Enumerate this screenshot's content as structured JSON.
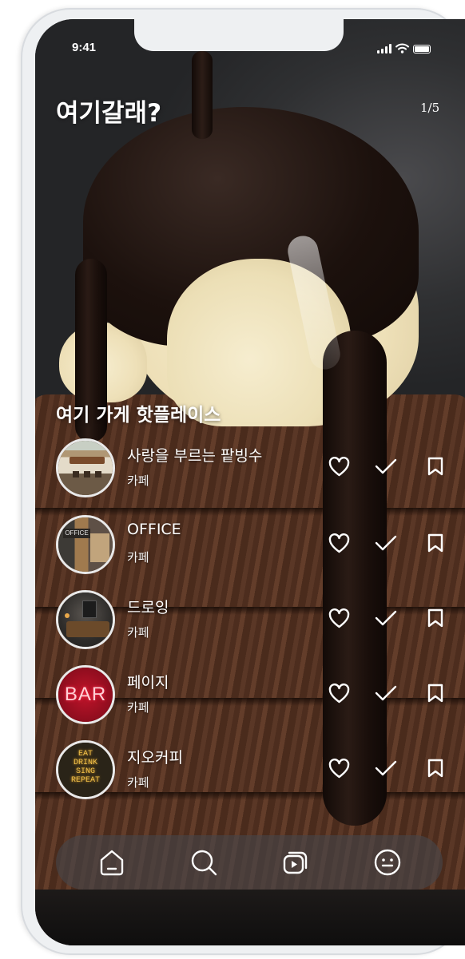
{
  "status": {
    "time": "9:41"
  },
  "header": {
    "title": "여기갈래?",
    "page_indicator": "1/5"
  },
  "section": {
    "title": "여기 가게 핫플레이스"
  },
  "places": [
    {
      "name": "사랑을 부르는 팥빙수",
      "category": "카페",
      "thumb": "storefront-sign"
    },
    {
      "name": "OFFICE",
      "category": "카페",
      "thumb": "office-storefront"
    },
    {
      "name": "드로잉",
      "category": "카페",
      "thumb": "cafe-interior"
    },
    {
      "name": "페이지",
      "category": "카페",
      "thumb": "bar-neon-sign"
    },
    {
      "name": "지오커피",
      "category": "카페",
      "thumb": "eat-drink-neon-sign"
    }
  ],
  "thumb_text": {
    "bar": "BAR",
    "eat_lines": [
      "EAT",
      "DRINK",
      "SING",
      "REPEAT"
    ]
  },
  "row_actions": [
    "heart-icon",
    "check-icon",
    "bookmark-icon"
  ],
  "nav": [
    "home-icon",
    "search-icon",
    "media-play-icon",
    "smile-icon"
  ],
  "colors": {
    "icon": "#ffffff",
    "nav_bg": "#46464a",
    "frame": "#eef0f2"
  }
}
